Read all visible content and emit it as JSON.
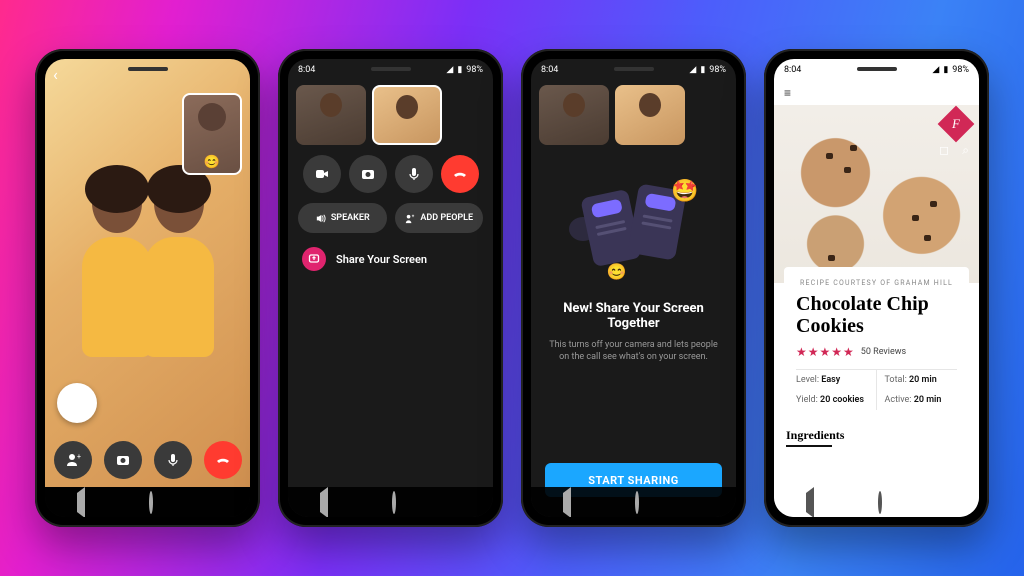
{
  "status": {
    "time": "8:04",
    "battery": "98%"
  },
  "phone1": {
    "pip_emoji": "😊"
  },
  "phone2": {
    "speaker_label": "SPEAKER",
    "add_people_label": "ADD PEOPLE",
    "share_label": "Share Your Screen"
  },
  "phone3": {
    "title": "New! Share Your Screen Together",
    "subtitle": "This turns off your camera and lets people on the call see what's on your screen.",
    "button_label": "START SHARING",
    "emoji_small": "😊",
    "emoji_big": "🤩"
  },
  "phone4": {
    "brand_letter": "F",
    "courtesy_line": "RECIPE COURTESY OF GRAHAM HILL",
    "title": "Chocolate Chip Cookies",
    "stars": "★★★★★",
    "reviews": "50 Reviews",
    "meta": {
      "level_k": "Level:",
      "level_v": "Easy",
      "total_k": "Total:",
      "total_v": "20 min",
      "yield_k": "Yield:",
      "yield_v": "20 cookies",
      "active_k": "Active:",
      "active_v": "20 min"
    },
    "ingredients_heading": "Ingredients"
  }
}
